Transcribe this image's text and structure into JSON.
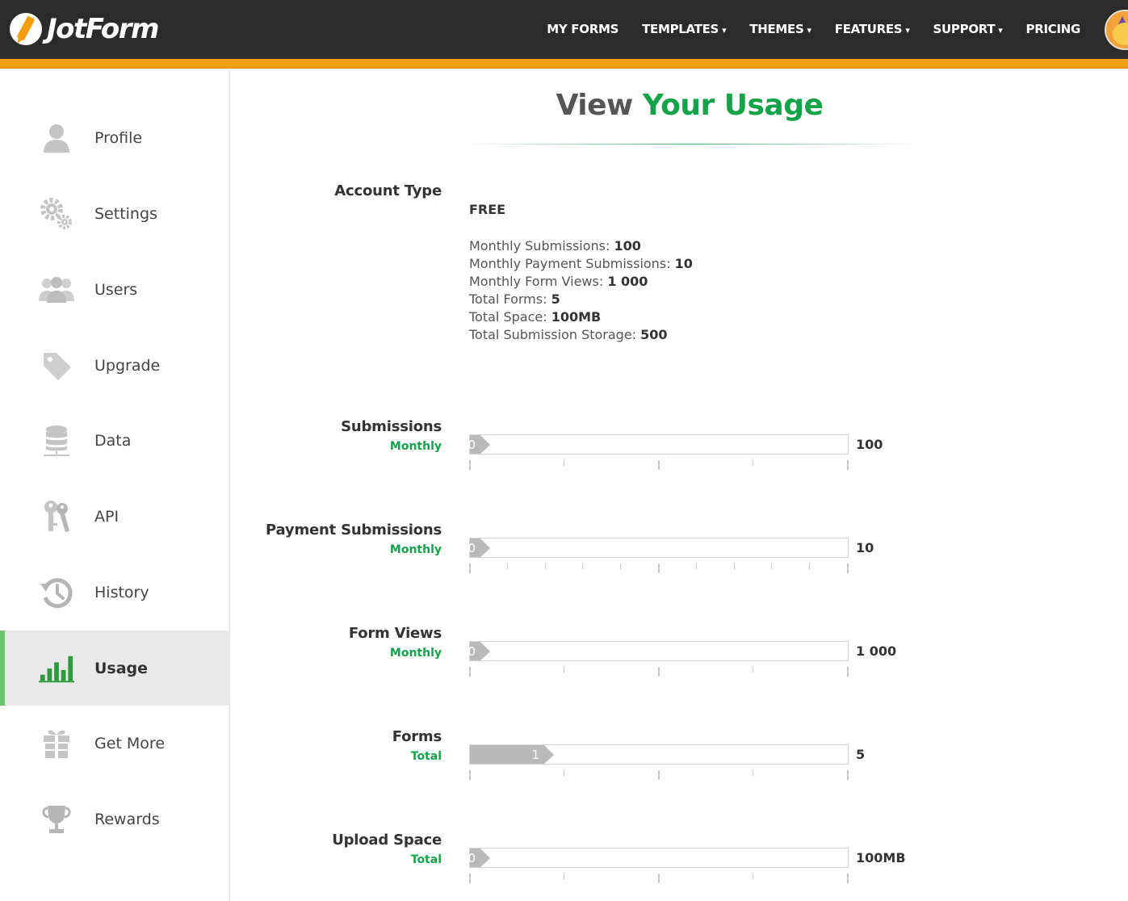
{
  "brand": {
    "name": "JotForm"
  },
  "nav": {
    "items": [
      {
        "label": "MY FORMS",
        "caret": ""
      },
      {
        "label": "TEMPLATES",
        "caret": "▾"
      },
      {
        "label": "THEMES",
        "caret": "▾"
      },
      {
        "label": "FEATURES",
        "caret": "▾"
      },
      {
        "label": "SUPPORT",
        "caret": "▾"
      },
      {
        "label": "PRICING",
        "caret": ""
      }
    ]
  },
  "sidebar": {
    "items": [
      {
        "label": "Profile",
        "icon": "user-icon"
      },
      {
        "label": "Settings",
        "icon": "gears-icon"
      },
      {
        "label": "Users",
        "icon": "users-icon"
      },
      {
        "label": "Upgrade",
        "icon": "tag-icon"
      },
      {
        "label": "Data",
        "icon": "database-icon"
      },
      {
        "label": "API",
        "icon": "keys-icon"
      },
      {
        "label": "History",
        "icon": "history-icon"
      },
      {
        "label": "Usage",
        "icon": "bar-chart-icon",
        "active": true
      },
      {
        "label": "Get More",
        "icon": "gift-icon"
      },
      {
        "label": "Rewards",
        "icon": "trophy-icon"
      }
    ]
  },
  "page": {
    "title_light": "View",
    "title_strong": "Your Usage"
  },
  "account": {
    "label": "Account Type",
    "type": "FREE",
    "limits": [
      {
        "name": "Monthly Submissions:",
        "value": "100"
      },
      {
        "name": "Monthly Payment Submissions:",
        "value": "10"
      },
      {
        "name": "Monthly Form Views:",
        "value": "1 000"
      },
      {
        "name": "Total Forms:",
        "value": "5"
      },
      {
        "name": "Total Space:",
        "value": "100MB"
      },
      {
        "name": "Total Submission Storage:",
        "value": "500"
      }
    ]
  },
  "usage": [
    {
      "label": "Submissions",
      "period": "Monthly",
      "used": "0",
      "max": "100",
      "fraction": 0,
      "ticks": 4
    },
    {
      "label": "Payment Submissions",
      "period": "Monthly",
      "used": "0",
      "max": "10",
      "fraction": 0,
      "ticks": 10
    },
    {
      "label": "Form Views",
      "period": "Monthly",
      "used": "0",
      "max": "1 000",
      "fraction": 0,
      "ticks": 4
    },
    {
      "label": "Forms",
      "period": "Total",
      "used": "1",
      "max": "5",
      "fraction": 0.2,
      "ticks": 4
    },
    {
      "label": "Upload Space",
      "period": "Total",
      "used": "0",
      "max": "100MB",
      "fraction": 0,
      "ticks": 4
    }
  ],
  "colors": {
    "accent": "#15a34a",
    "topbar": "#2b2b2b",
    "topbar_stripe": "#f59e0b",
    "bar_fill": "#b9b9b9"
  }
}
